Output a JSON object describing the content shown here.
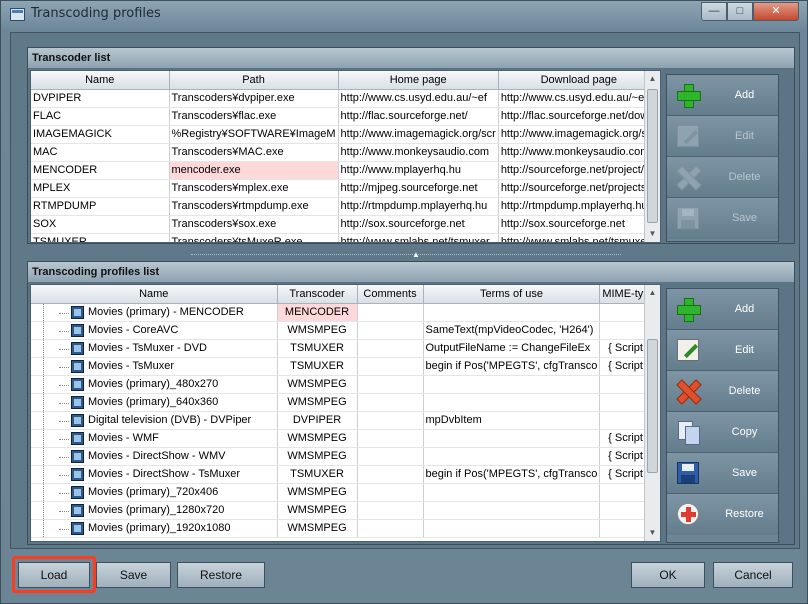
{
  "window": {
    "title": "Transcoding profiles",
    "controls": {
      "minimize": "—",
      "maximize": "□",
      "close": "✕"
    }
  },
  "transcoder_list": {
    "title": "Transcoder list",
    "columns": [
      "Name",
      "Path",
      "Home page",
      "Download page"
    ],
    "rows": [
      [
        "DVPIPER",
        "Transcoders¥dvpiper.exe",
        "http://www.cs.usyd.edu.au/~ef",
        "http://www.cs.usyd.edu.au/~e"
      ],
      [
        "FLAC",
        "Transcoders¥flac.exe",
        "http://flac.sourceforge.net/",
        "http://flac.sourceforge.net/dow"
      ],
      [
        "IMAGEMAGICK",
        "%Registry¥SOFTWARE¥ImageM",
        "http://www.imagemagick.org/scr",
        "http://www.imagemagick.org/sc"
      ],
      [
        "MAC",
        "Transcoders¥MAC.exe",
        "http://www.monkeysaudio.com",
        "http://www.monkeysaudio.com/"
      ],
      [
        "MENCODER",
        "mencoder.exe",
        "http://www.mplayerhq.hu",
        "http://sourceforge.net/project/s"
      ],
      [
        "MPLEX",
        "Transcoders¥mplex.exe",
        "http://mjpeg.sourceforge.net",
        "http://sourceforge.net/projects/"
      ],
      [
        "RTMPDUMP",
        "Transcoders¥rtmpdump.exe",
        "http://rtmpdump.mplayerhq.hu",
        "http://rtmpdump.mplayerhq.hu/"
      ],
      [
        "SOX",
        "Transcoders¥sox.exe",
        "http://sox.sourceforge.net",
        "http://sox.sourceforge.net"
      ],
      [
        "TSMUXER",
        "Transcoders¥tsMuxeR.exe",
        "http://www.smlabs.net/tsmuxer",
        "http://www.smlabs.net/tsmuxer"
      ]
    ],
    "selected_cell": {
      "row": 4,
      "col": 1
    },
    "buttons": {
      "add": "Add",
      "edit": "Edit",
      "delete": "Delete",
      "save": "Save"
    }
  },
  "profiles_list": {
    "title": "Transcoding profiles list",
    "columns": [
      "Name",
      "Transcoder",
      "Comments",
      "Terms of use",
      "MIME-type"
    ],
    "rows": [
      [
        "Movies (primary) - MENCODER",
        "MENCODER",
        "",
        "",
        ""
      ],
      [
        "Movies - CoreAVC",
        "WMSMPEG",
        "",
        "SameText(mpVideoCodec, 'H264')",
        ""
      ],
      [
        "Movies - TsMuxer - DVD",
        "TSMUXER",
        "",
        "OutputFileName := ChangeFileEx",
        "{ Script }"
      ],
      [
        "Movies - TsMuxer",
        "TSMUXER",
        "",
        "begin if Pos('MPEGTS', cfgTransco",
        "{ Script }"
      ],
      [
        "Movies (primary)_480x270",
        "WMSMPEG",
        "",
        "",
        ""
      ],
      [
        "Movies (primary)_640x360",
        "WMSMPEG",
        "",
        "",
        ""
      ],
      [
        "Digital television (DVB) - DVPiper",
        "DVPIPER",
        "",
        "mpDvbItem",
        ""
      ],
      [
        "Movies - WMF",
        "WMSMPEG",
        "",
        "",
        "{ Script }"
      ],
      [
        "Movies - DirectShow - WMV",
        "WMSMPEG",
        "",
        "",
        "{ Script }"
      ],
      [
        "Movies - DirectShow - TsMuxer",
        "TSMUXER",
        "",
        "begin if Pos('MPEGTS', cfgTransco",
        "{ Script }"
      ],
      [
        "Movies (primary)_720x406",
        "WMSMPEG",
        "",
        "",
        ""
      ],
      [
        "Movies (primary)_1280x720",
        "WMSMPEG",
        "",
        "",
        ""
      ],
      [
        "Movies (primary)_1920x1080",
        "WMSMPEG",
        "",
        "",
        ""
      ]
    ],
    "selected_cell": {
      "row": 0,
      "col": 1
    },
    "buttons": {
      "add": "Add",
      "edit": "Edit",
      "delete": "Delete",
      "copy": "Copy",
      "save": "Save",
      "restore": "Restore"
    }
  },
  "footer": {
    "load": "Load",
    "save": "Save",
    "restore": "Restore",
    "ok": "OK",
    "cancel": "Cancel"
  },
  "colors": {
    "selected_cell": "#ffd9d9",
    "highlight_box": "#ff3b1f"
  }
}
